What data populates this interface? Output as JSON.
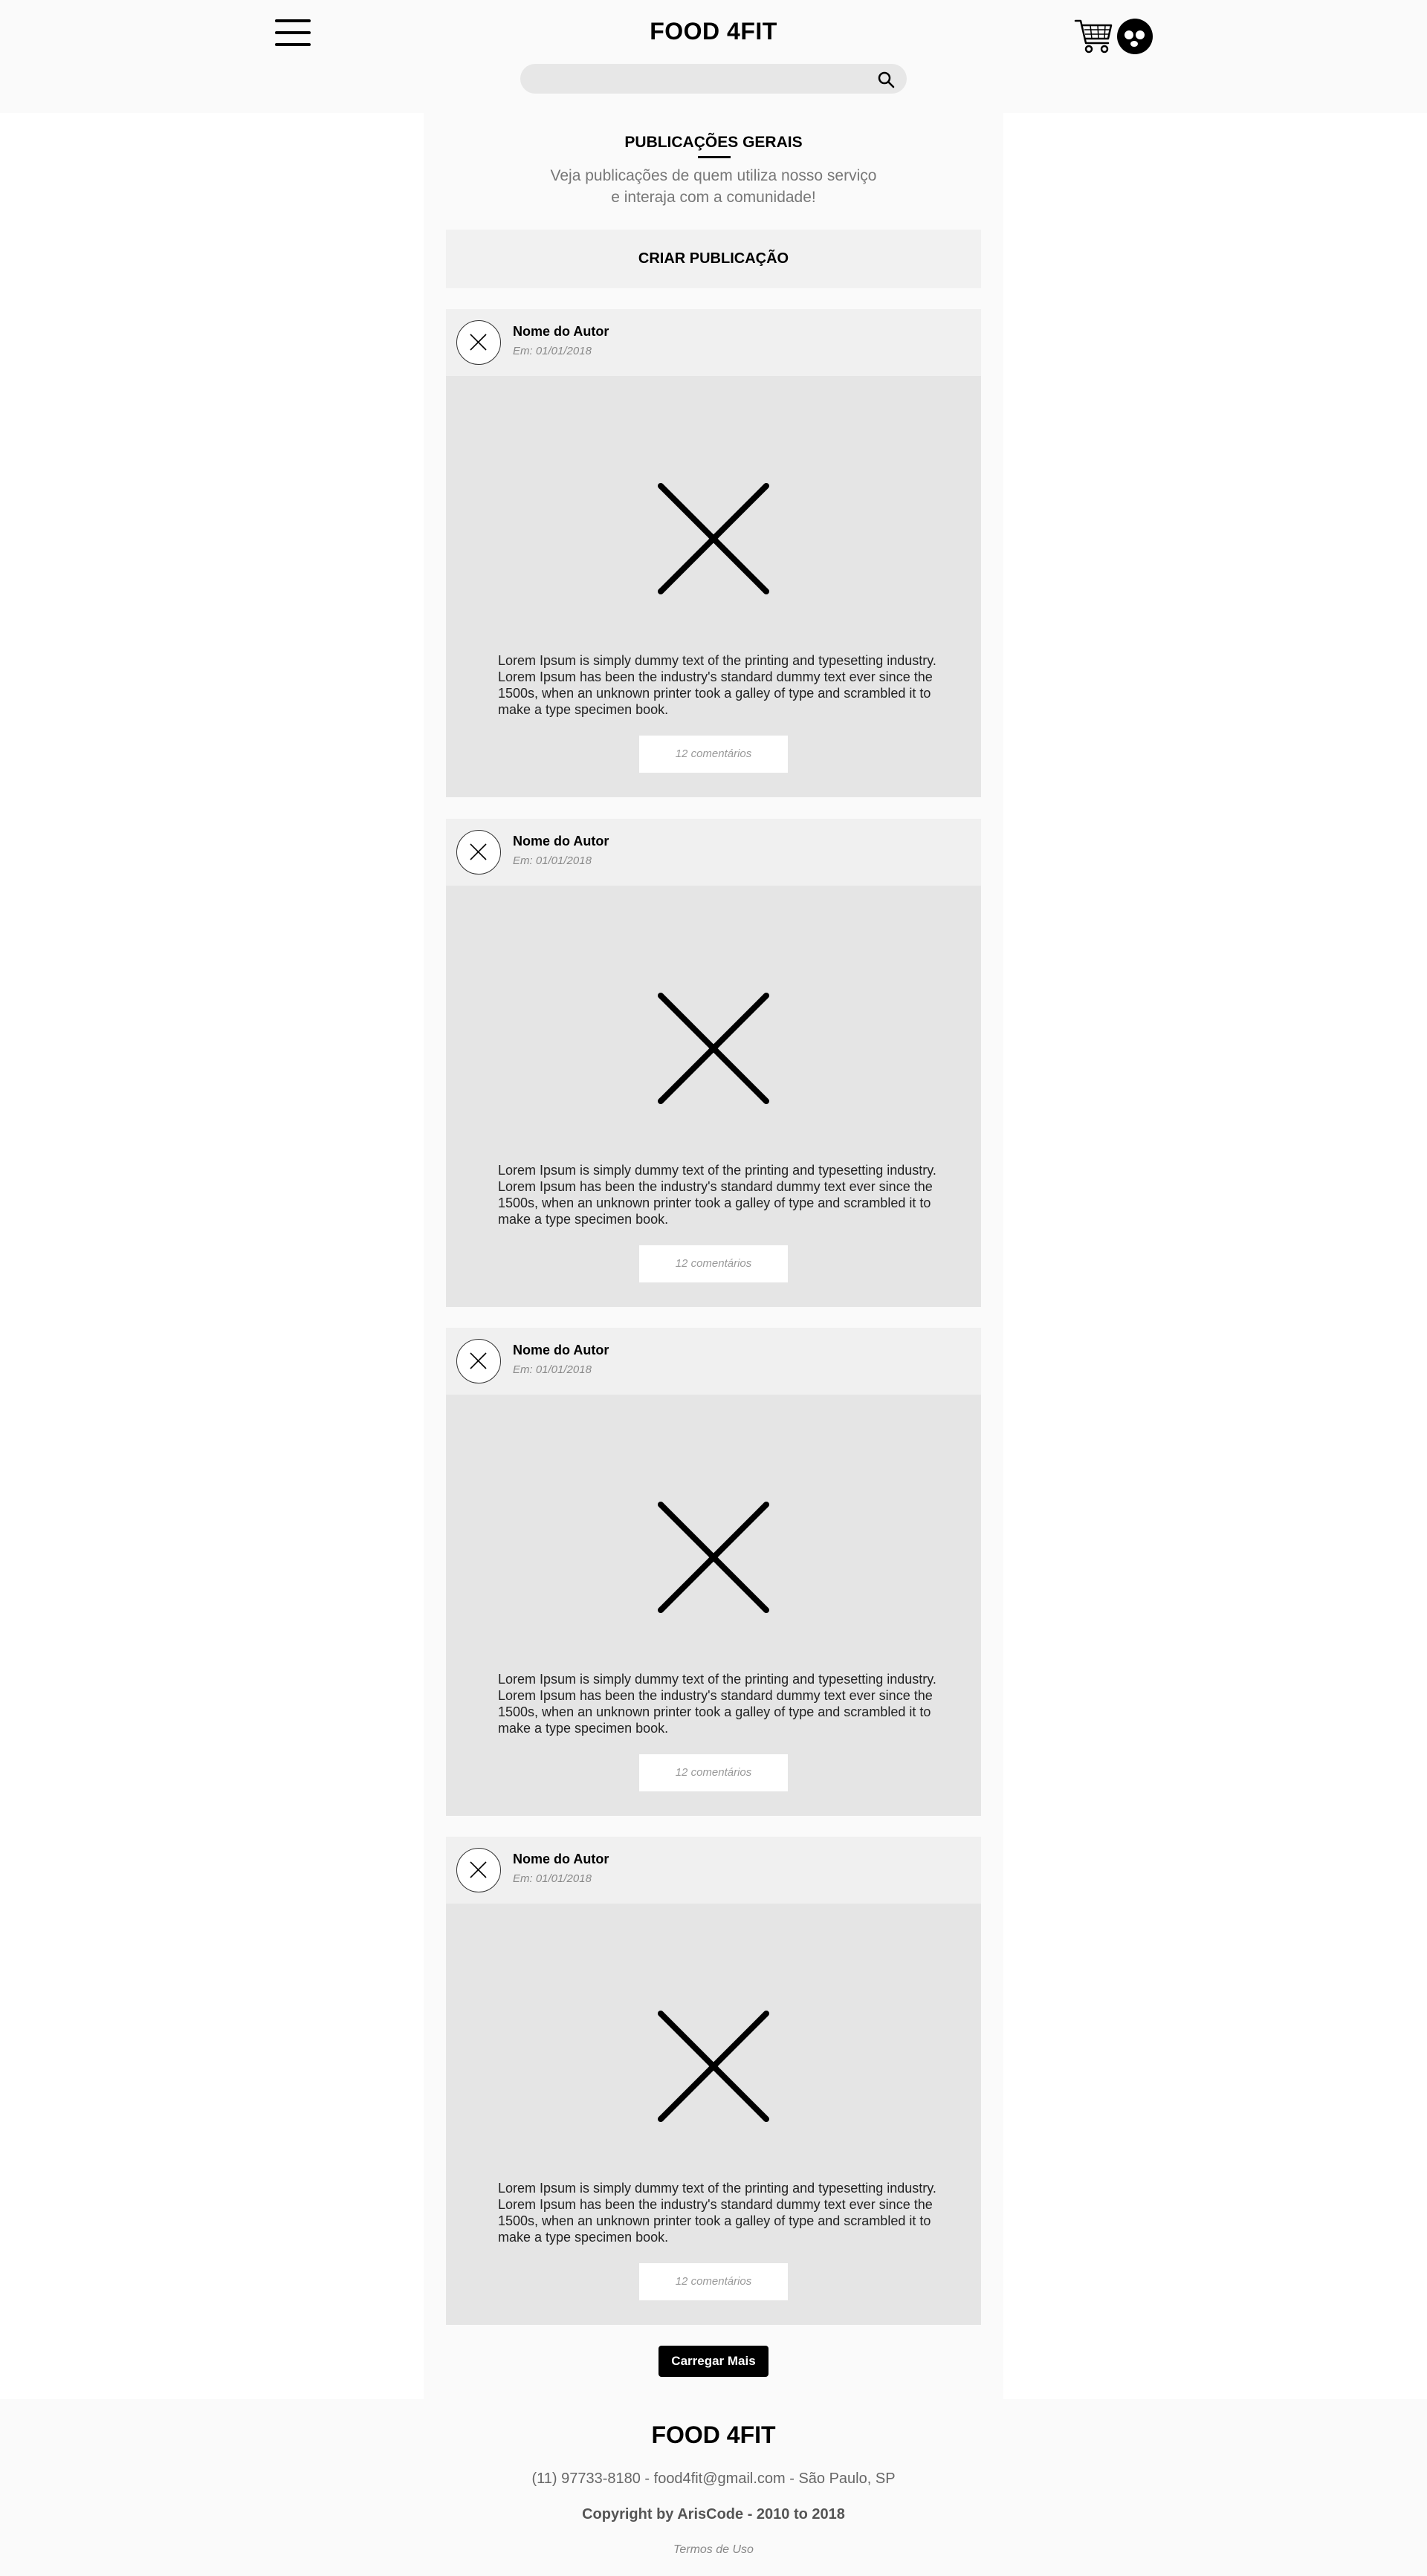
{
  "header": {
    "brand": "FOOD 4FIT",
    "search_placeholder": ""
  },
  "feed": {
    "title": "PUBLICAÇÕES GERAIS",
    "subtitle_line1": "Veja publicações de quem utiliza nosso serviço",
    "subtitle_line2": "e interaja com a comunidade!",
    "create_label": "CRIAR PUBLICAÇÃO",
    "posts": [
      {
        "author": "Nome do Autor",
        "date": "Em: 01/01/2018",
        "text": "Lorem Ipsum is simply dummy text of the printing and typesetting industry. Lorem Ipsum has been the industry's standard dummy text ever since the 1500s, when an unknown printer took a galley of type and scrambled it to make a type specimen book.",
        "comments": "12 comentários"
      },
      {
        "author": "Nome do Autor",
        "date": "Em: 01/01/2018",
        "text": "Lorem Ipsum is simply dummy text of the printing and typesetting industry. Lorem Ipsum has been the industry's standard dummy text ever since the 1500s, when an unknown printer took a galley of type and scrambled it to make a type specimen book.",
        "comments": "12 comentários"
      },
      {
        "author": "Nome do Autor",
        "date": "Em: 01/01/2018",
        "text": "Lorem Ipsum is simply dummy text of the printing and typesetting industry. Lorem Ipsum has been the industry's standard dummy text ever since the 1500s, when an unknown printer took a galley of type and scrambled it to make a type specimen book.",
        "comments": "12 comentários"
      },
      {
        "author": "Nome do Autor",
        "date": "Em: 01/01/2018",
        "text": "Lorem Ipsum is simply dummy text of the printing and typesetting industry. Lorem Ipsum has been the industry's standard dummy text ever since the 1500s, when an unknown printer took a galley of type and scrambled it to make a type specimen book.",
        "comments": "12 comentários"
      }
    ],
    "load_more_label": "Carregar Mais"
  },
  "footer": {
    "brand": "FOOD 4FIT",
    "contact": "(11) 97733-8180 - food4fit@gmail.com - São Paulo, SP",
    "copyright": "Copyright by ArisCode - 2010 to 2018",
    "terms": "Termos de Uso"
  },
  "icons": {
    "menu": "hamburger-menu-icon",
    "cart": "shopping-cart-icon",
    "profile": "user-avatar-icon",
    "search": "search-icon",
    "placeholder_image": "image-placeholder-icon"
  }
}
